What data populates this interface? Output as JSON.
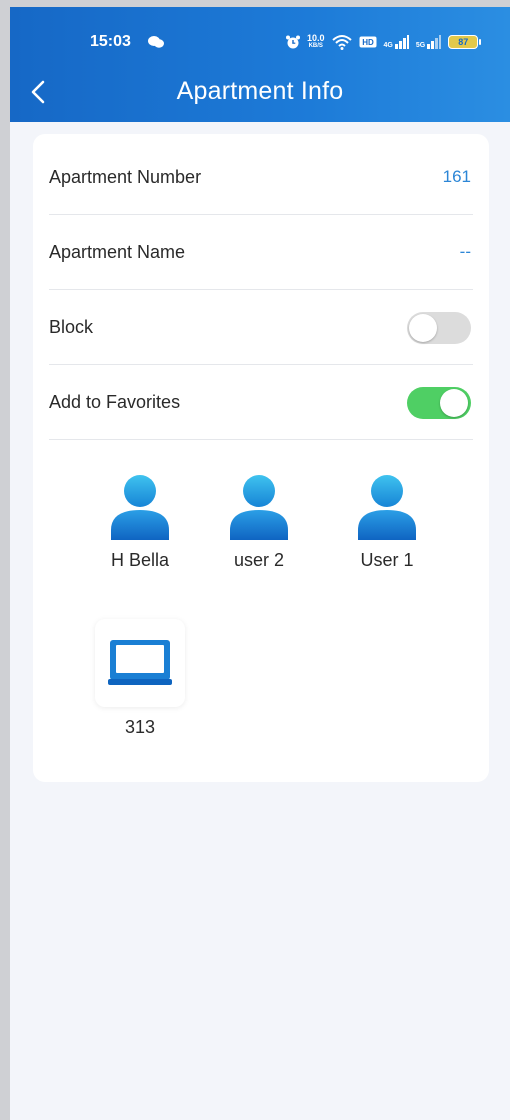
{
  "status": {
    "time": "15:03",
    "network_speed": "10.0",
    "network_unit": "KB/S",
    "signal_label_1": "4G",
    "signal_label_2": "5G",
    "battery": "87"
  },
  "header": {
    "title": "Apartment Info"
  },
  "rows": {
    "number": {
      "label": "Apartment Number",
      "value": "161"
    },
    "name": {
      "label": "Apartment Name",
      "value": "--"
    },
    "block": {
      "label": "Block",
      "enabled": false
    },
    "favorites": {
      "label": "Add to Favorites",
      "enabled": true
    }
  },
  "members": [
    {
      "name": "H Bella",
      "icon": "user-icon"
    },
    {
      "name": "user 2",
      "icon": "user-icon"
    },
    {
      "name": "User 1",
      "icon": "user-icon"
    }
  ],
  "devices": [
    {
      "name": "313",
      "icon": "indoor-monitor-icon"
    }
  ],
  "colors": {
    "appbar": "#1d7bd8",
    "accent_value": "#2c86d6",
    "toggle_on": "#4fcf64",
    "toggle_off": "#dcdcdc",
    "background": "#f3f5fa"
  }
}
